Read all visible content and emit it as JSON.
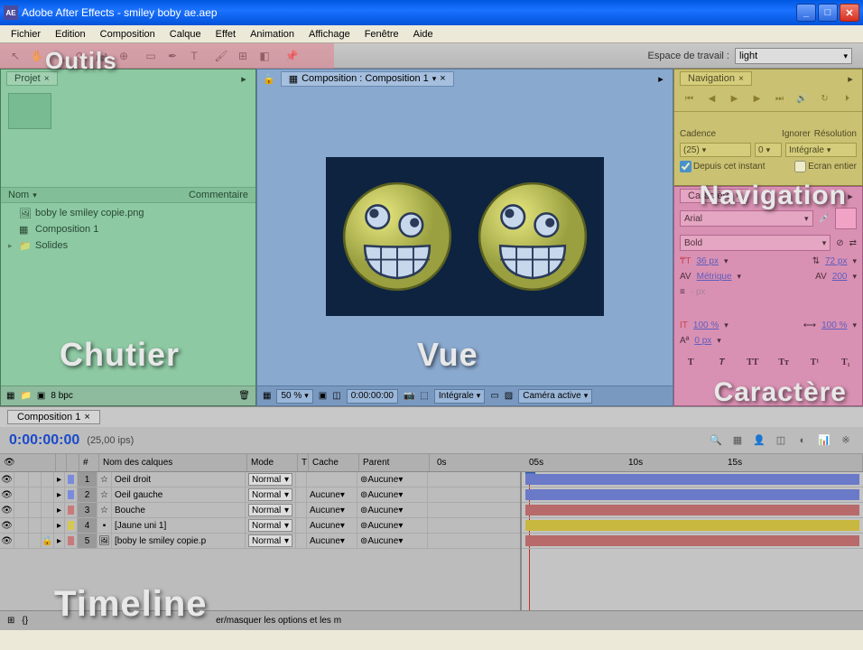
{
  "window": {
    "title": "Adobe After Effects - smiley boby ae.aep"
  },
  "menu": [
    "Fichier",
    "Edition",
    "Composition",
    "Calque",
    "Effet",
    "Animation",
    "Affichage",
    "Fenêtre",
    "Aide"
  ],
  "workspace": {
    "label": "Espace de travail :",
    "value": "light"
  },
  "overlays": {
    "outils": "Outils",
    "chutier": "Chutier",
    "vue": "Vue",
    "navigation": "Navigation",
    "caractere": "Caractère",
    "timeline": "Timeline"
  },
  "project": {
    "tab": "Projet",
    "col_name": "Nom",
    "col_comment": "Commentaire",
    "items": [
      {
        "icon": "image",
        "name": "boby le smiley copie.png"
      },
      {
        "icon": "comp",
        "name": "Composition 1"
      },
      {
        "icon": "folder",
        "name": "Solides",
        "expandable": true
      }
    ],
    "bpc": "8 bpc"
  },
  "comp": {
    "tab": "Composition : Composition 1",
    "zoom": "50 %",
    "timecode": "0:00:00:00",
    "res": "Intégrale",
    "camera": "Caméra active"
  },
  "nav": {
    "tab": "Navigation",
    "row_labels": {
      "cadence": "Cadence",
      "ignorer": "Ignorer",
      "resolution": "Résolution"
    },
    "cadence": "(25)",
    "ignorer": "0",
    "resolution": "Intégrale",
    "depuis": "Depuis cet instant",
    "ecran": "Ecran entier"
  },
  "char": {
    "tab": "Caractère",
    "font": "Arial",
    "style": "Bold",
    "size": "36 px",
    "leading": "72 px",
    "kerning": "Métrique",
    "tracking": "200",
    "vscale": "100 %",
    "hscale": "100 %",
    "baseline": "0 px"
  },
  "timeline": {
    "tab": "Composition 1",
    "time": "0:00:00:00",
    "fps": "(25,00 ips)",
    "col_num": "#",
    "col_name": "Nom des calques",
    "col_mode": "Mode",
    "col_t": "T",
    "col_cache": "Cache",
    "col_parent": "Parent",
    "mode_val": "Normal",
    "cache_val": "Aucune",
    "parent_val": "Aucune",
    "ticks": [
      "0s",
      "05s",
      "10s",
      "15s"
    ],
    "layers": [
      {
        "num": "1",
        "color": "#7a8adc",
        "name": "Oeil droit",
        "icon": "star",
        "bar": "#6a7ac8"
      },
      {
        "num": "2",
        "color": "#7a8adc",
        "name": "Oeil gauche",
        "icon": "star",
        "bar": "#6a7ac8"
      },
      {
        "num": "3",
        "color": "#c87a7a",
        "name": "Bouche",
        "icon": "star",
        "bar": "#b86a6a"
      },
      {
        "num": "4",
        "color": "#d8c850",
        "name": "[Jaune uni 1]",
        "icon": "solid",
        "bar": "#c8b840"
      },
      {
        "num": "5",
        "color": "#c87a7a",
        "name": "[boby le smiley copie.p",
        "icon": "image",
        "bar": "#b86a6a",
        "locked": true
      }
    ],
    "status": "er/masquer les options et les m"
  }
}
